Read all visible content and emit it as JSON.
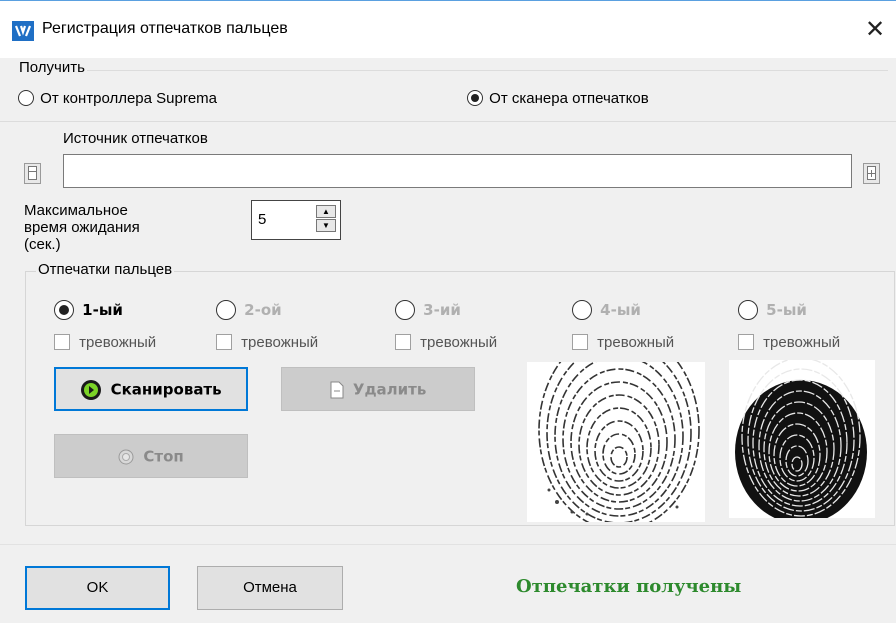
{
  "window": {
    "title": "Регистрация отпечатков пальцев",
    "icon": "app-logo-icon",
    "close": "✕"
  },
  "obtain": {
    "group_label": "Получить",
    "options": [
      {
        "label": "От контроллера Suprema",
        "checked": false
      },
      {
        "label": "От сканера отпечатков",
        "checked": true
      }
    ]
  },
  "source": {
    "label": "Источник отпечатков",
    "value": ""
  },
  "timeout": {
    "label_lines": [
      "Максимальное",
      "время ожидания",
      "(сек.)"
    ],
    "value": "5",
    "up": "▲",
    "down": "▼"
  },
  "fingers": {
    "group_label": "Отпечатки пальцев",
    "slots": [
      {
        "label": "1-ый",
        "selected": true,
        "enabled": true,
        "alarm_label": "тревожный"
      },
      {
        "label": "2-ой",
        "selected": false,
        "enabled": false,
        "alarm_label": "тревожный"
      },
      {
        "label": "3-ий",
        "selected": false,
        "enabled": false,
        "alarm_label": "тревожный"
      },
      {
        "label": "4-ый",
        "selected": false,
        "enabled": false,
        "alarm_label": "тревожный"
      },
      {
        "label": "5-ый",
        "selected": false,
        "enabled": false,
        "alarm_label": "тревожный"
      }
    ],
    "scan_label": "Сканировать",
    "delete_label": "Удалить",
    "stop_label": "Стоп"
  },
  "footer": {
    "ok_label": "OK",
    "cancel_label": "Отмена",
    "status": "Отпечатки получены"
  },
  "colors": {
    "accent": "#0078d7",
    "status_green": "#2d8a2d",
    "app_icon_blue": "#1f6fc5"
  }
}
